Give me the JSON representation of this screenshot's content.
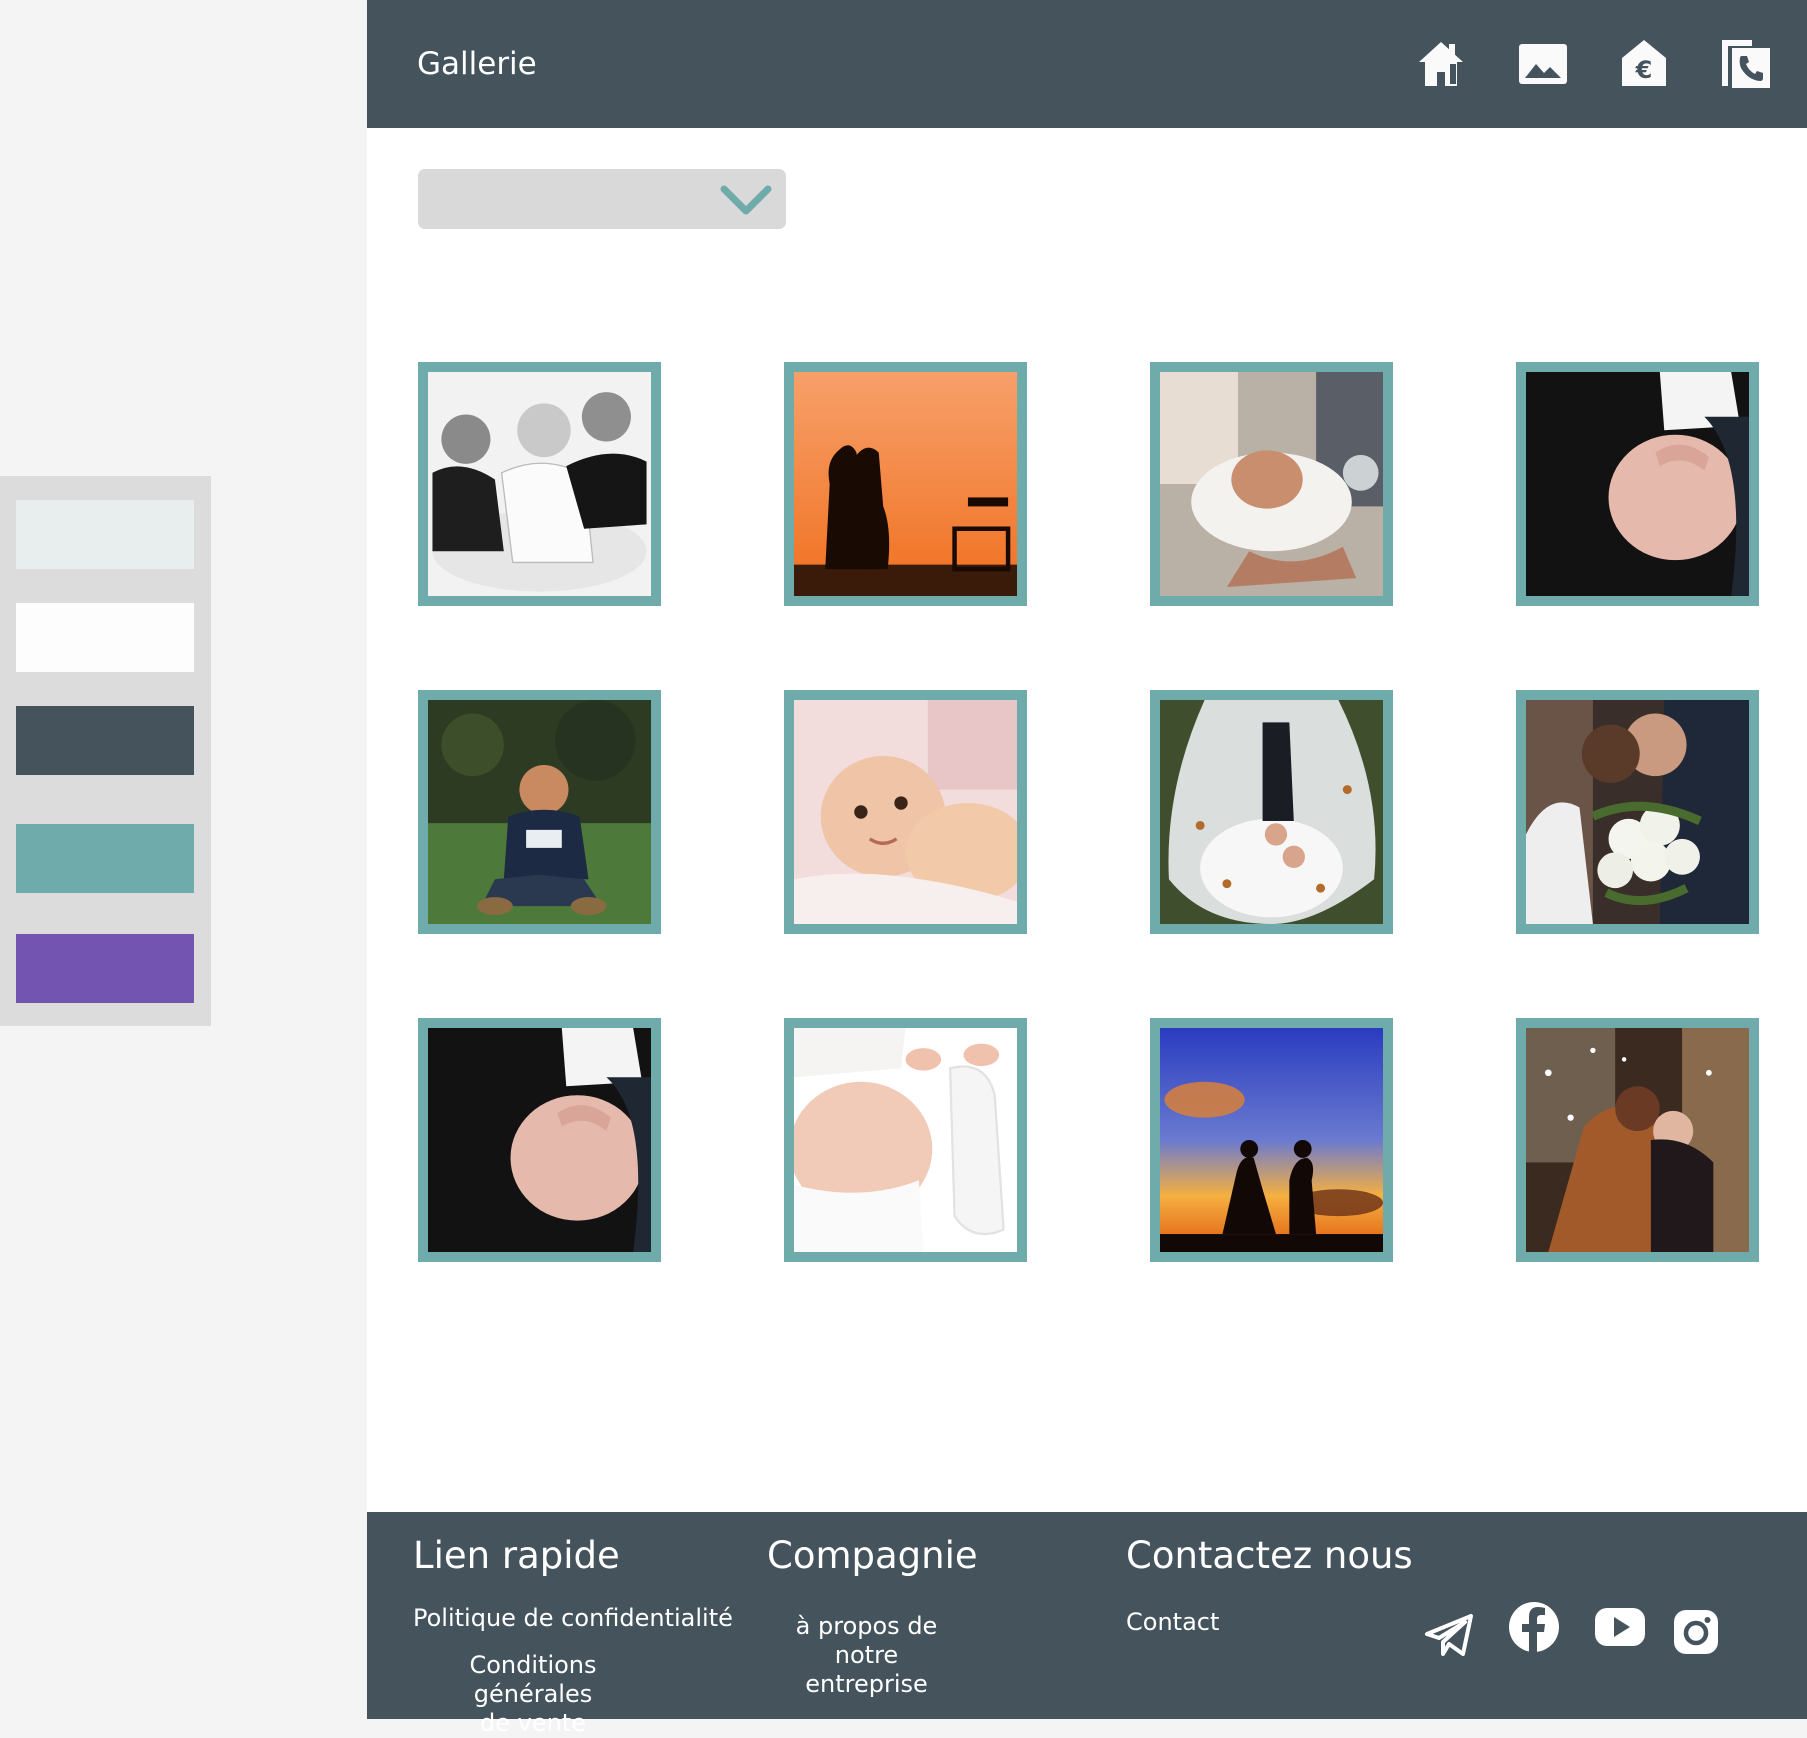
{
  "colors": {
    "primary_dark": "#44535c",
    "accent_teal": "#6fabab",
    "accent_purple": "#7354b1",
    "light": "#e7eeed",
    "white": "#fdfdfd",
    "dropdown_bg": "#d9d9d9"
  },
  "palette": {
    "swatches": [
      "#e7eeed",
      "#fdfdfd",
      "#44535c",
      "#6fabab",
      "#7354b1"
    ]
  },
  "header": {
    "title": "Gallerie",
    "nav": [
      {
        "icon": "home-icon"
      },
      {
        "icon": "image-icon"
      },
      {
        "icon": "price-euro-icon"
      },
      {
        "icon": "contact-phone-icon"
      }
    ]
  },
  "filter": {
    "selected": "",
    "icon": "chevron-down-icon"
  },
  "gallery": {
    "photos": [
      {
        "subject": "family-black-white"
      },
      {
        "subject": "couple-silhouette-orange-sky"
      },
      {
        "subject": "baby-held"
      },
      {
        "subject": "pregnant-belly-dark"
      },
      {
        "subject": "baby-sitting-grass"
      },
      {
        "subject": "baby-lying-smiling"
      },
      {
        "subject": "wedding-couple-lying"
      },
      {
        "subject": "wedding-kiss-bouquet"
      },
      {
        "subject": "pregnant-belly-dark-2"
      },
      {
        "subject": "pregnant-belly-white"
      },
      {
        "subject": "wedding-sunset-silhouette"
      },
      {
        "subject": "couple-kiss-winter"
      }
    ]
  },
  "footer": {
    "quick_links": {
      "heading": "Lien rapide",
      "privacy": "Politique de confidentialité",
      "terms_line1": "Conditions générales",
      "terms_line2": "de vente"
    },
    "company": {
      "heading": "Compagnie",
      "about_line1": "à propos de notre",
      "about_line2": "entreprise"
    },
    "contact": {
      "heading": "Contactez nous",
      "contact_link": "Contact"
    },
    "social": [
      "telegram-icon",
      "facebook-icon",
      "youtube-icon",
      "instagram-icon"
    ]
  }
}
